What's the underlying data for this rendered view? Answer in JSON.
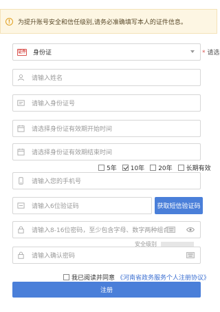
{
  "notice": {
    "icon": "info-icon",
    "text": "为提升账号安全和信任级别,请务必准确填写本人的证件信息。"
  },
  "id_type": {
    "badge": "证件",
    "value": "身份证",
    "required_label": "请选",
    "required_mark": "*"
  },
  "fields": {
    "name_placeholder": "请输入姓名",
    "id_number_placeholder": "请输入身份证号",
    "valid_start_placeholder": "请选择身份证有效期开始时间",
    "valid_end_placeholder": "请选择身份证有效期结束时间",
    "phone_placeholder": "请输入您的手机号",
    "sms_code_placeholder": "请输入6位验证码",
    "password_placeholder": "请输入8-16位密码，至少包含字母、数字两种组合",
    "confirm_password_placeholder": "请输入确认密码"
  },
  "validity_options": [
    {
      "label": "5年",
      "checked": false
    },
    {
      "label": "10年",
      "checked": true
    },
    {
      "label": "20年",
      "checked": false
    },
    {
      "label": "长期有效",
      "checked": false
    }
  ],
  "sms_button_label": "获取短信验证码",
  "password_strength": {
    "label": "安全级别",
    "level": 0
  },
  "agreement": {
    "checked": false,
    "text": "我已阅读并同意",
    "link": "《河南省政务服务个人注册协议》"
  },
  "submit_label": "注册",
  "colors": {
    "primary": "#4a7fd9",
    "notice_bg": "#fdf6e3",
    "warning": "#e0a021",
    "required": "#d9534f",
    "link": "#3b6fd1"
  }
}
